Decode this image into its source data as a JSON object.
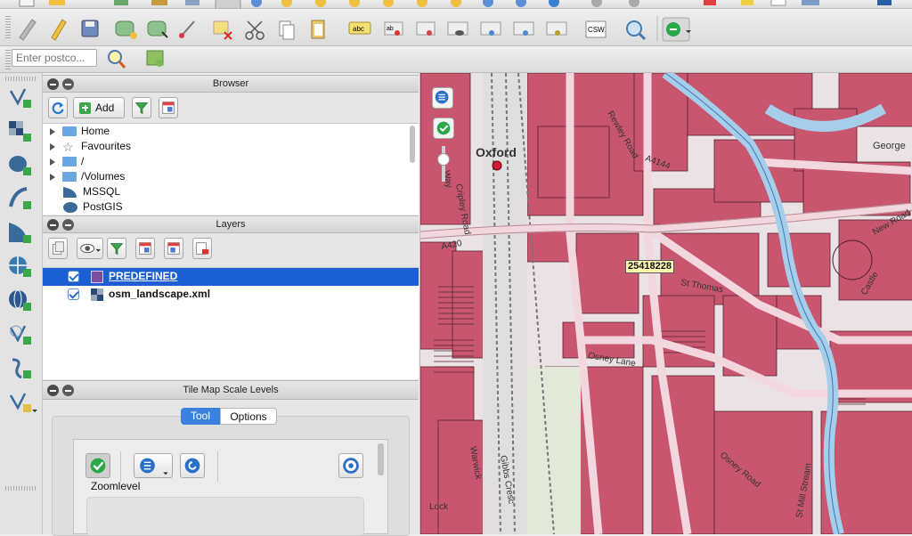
{
  "search": {
    "placeholder": "Enter postco..."
  },
  "browser": {
    "title": "Browser",
    "add_label": "Add",
    "items": [
      {
        "label": "Home"
      },
      {
        "label": "Favourites"
      },
      {
        "label": "/"
      },
      {
        "label": "/Volumes"
      },
      {
        "label": "MSSQL"
      },
      {
        "label": "PostGIS"
      }
    ]
  },
  "layers": {
    "title": "Layers",
    "items": [
      {
        "label": "PREDEFINED",
        "checked": true,
        "selected": true
      },
      {
        "label": "osm_landscape.xml",
        "checked": true,
        "selected": false
      }
    ]
  },
  "tilemap": {
    "title": "Tile Map Scale Levels",
    "tabs": [
      {
        "label": "Tool",
        "active": true
      },
      {
        "label": "Options",
        "active": false
      }
    ],
    "zoom_label": "Zoomlevel"
  },
  "map": {
    "labels": {
      "oxford": "Oxford",
      "cripley": "Cripley Road",
      "way": "Way",
      "a4144": "A4144",
      "rewley": "Rewley Road",
      "a420": "A420",
      "george": "George",
      "newroad": "New Road",
      "osney": "Osney Lane",
      "thomas": "St Thomas",
      "gibbs": "Gibbs Cresc",
      "mill": "St Mill Stream",
      "osney2": "Osney Road",
      "wark": "Warwick",
      "lock": "Lock",
      "castle": "Castle"
    },
    "tooltip": "25418228",
    "colors": {
      "building": "#c8566f",
      "land": "#e9d7db",
      "water": "#9cc8e6",
      "rail": "#d9d9d9"
    }
  }
}
